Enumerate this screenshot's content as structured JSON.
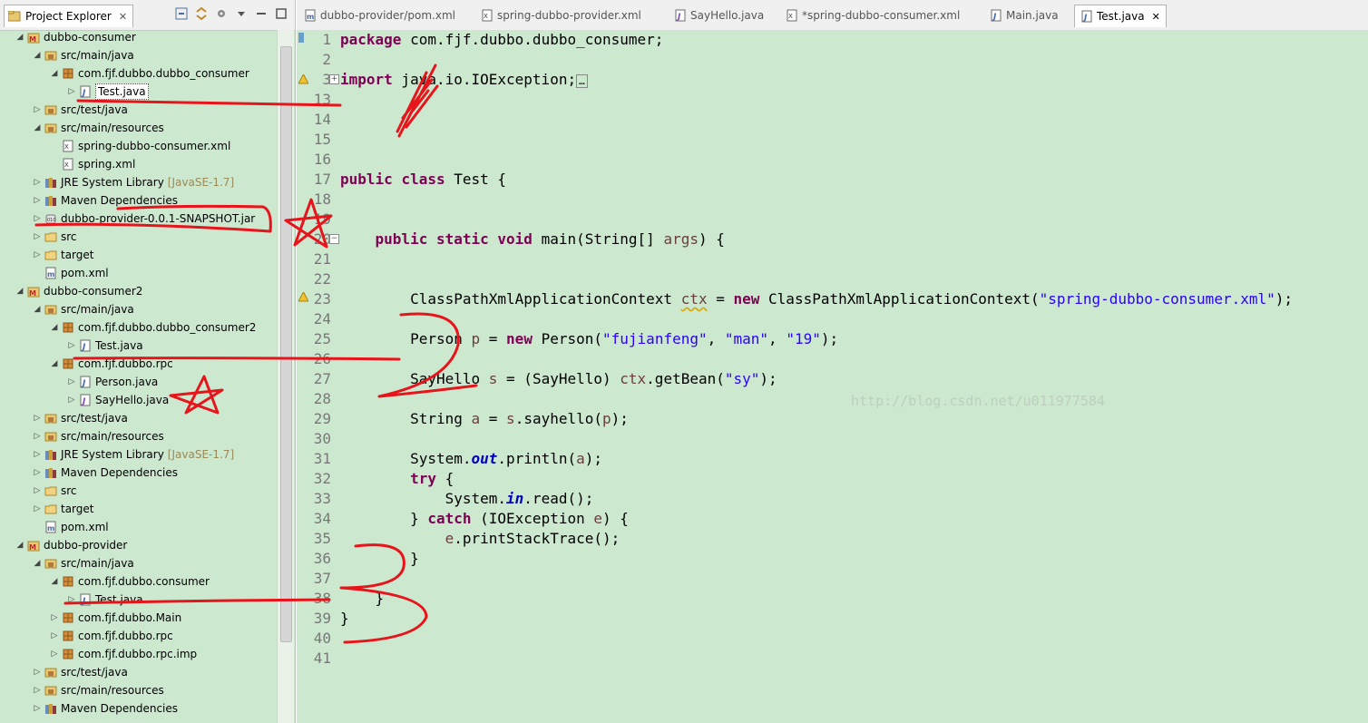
{
  "explorer": {
    "tab_title": "Project Explorer",
    "tab_close": "✕",
    "tree": [
      {
        "label": "dubbo-consumer",
        "level": 0,
        "twisty": "◢",
        "icon": "maven-project-icon"
      },
      {
        "label": "src/main/java",
        "level": 1,
        "twisty": "◢",
        "icon": "source-folder-icon"
      },
      {
        "label": "com.fjf.dubbo.dubbo_consumer",
        "level": 2,
        "twisty": "◢",
        "icon": "package-icon"
      },
      {
        "label": "Test.java",
        "level": 3,
        "twisty": "▷",
        "icon": "java-file-icon",
        "selected": true
      },
      {
        "label": "src/test/java",
        "level": 1,
        "twisty": "▷",
        "icon": "source-folder-icon"
      },
      {
        "label": "src/main/resources",
        "level": 1,
        "twisty": "◢",
        "icon": "source-folder-icon"
      },
      {
        "label": "spring-dubbo-consumer.xml",
        "level": 2,
        "twisty": "",
        "icon": "xml-file-icon"
      },
      {
        "label": "spring.xml",
        "level": 2,
        "twisty": "",
        "icon": "xml-file-icon"
      },
      {
        "label": "JRE System Library",
        "suffix": "[JavaSE-1.7]",
        "level": 1,
        "twisty": "▷",
        "icon": "library-icon"
      },
      {
        "label": "Maven Dependencies",
        "level": 1,
        "twisty": "▷",
        "icon": "library-icon"
      },
      {
        "label": "dubbo-provider-0.0.1-SNAPSHOT.jar",
        "level": 1,
        "twisty": "▷",
        "icon": "jar-icon"
      },
      {
        "label": "src",
        "level": 1,
        "twisty": "▷",
        "icon": "folder-icon"
      },
      {
        "label": "target",
        "level": 1,
        "twisty": "▷",
        "icon": "folder-icon"
      },
      {
        "label": "pom.xml",
        "level": 1,
        "twisty": "",
        "icon": "pom-file-icon"
      },
      {
        "label": "dubbo-consumer2",
        "level": 0,
        "twisty": "◢",
        "icon": "maven-project-icon"
      },
      {
        "label": "src/main/java",
        "level": 1,
        "twisty": "◢",
        "icon": "source-folder-icon"
      },
      {
        "label": "com.fjf.dubbo.dubbo_consumer2",
        "level": 2,
        "twisty": "◢",
        "icon": "package-icon"
      },
      {
        "label": "Test.java",
        "level": 3,
        "twisty": "▷",
        "icon": "java-file-icon"
      },
      {
        "label": "com.fjf.dubbo.rpc",
        "level": 2,
        "twisty": "◢",
        "icon": "package-icon"
      },
      {
        "label": "Person.java",
        "level": 3,
        "twisty": "▷",
        "icon": "java-file-icon"
      },
      {
        "label": "SayHello.java",
        "level": 3,
        "twisty": "▷",
        "icon": "java-interface-icon"
      },
      {
        "label": "src/test/java",
        "level": 1,
        "twisty": "▷",
        "icon": "source-folder-icon"
      },
      {
        "label": "src/main/resources",
        "level": 1,
        "twisty": "▷",
        "icon": "source-folder-icon"
      },
      {
        "label": "JRE System Library",
        "suffix": "[JavaSE-1.7]",
        "level": 1,
        "twisty": "▷",
        "icon": "library-icon"
      },
      {
        "label": "Maven Dependencies",
        "level": 1,
        "twisty": "▷",
        "icon": "library-icon"
      },
      {
        "label": "src",
        "level": 1,
        "twisty": "▷",
        "icon": "folder-icon"
      },
      {
        "label": "target",
        "level": 1,
        "twisty": "▷",
        "icon": "folder-icon"
      },
      {
        "label": "pom.xml",
        "level": 1,
        "twisty": "",
        "icon": "pom-file-icon"
      },
      {
        "label": "dubbo-provider",
        "level": 0,
        "twisty": "◢",
        "icon": "maven-project-icon"
      },
      {
        "label": "src/main/java",
        "level": 1,
        "twisty": "◢",
        "icon": "source-folder-icon"
      },
      {
        "label": "com.fjf.dubbo.consumer",
        "level": 2,
        "twisty": "◢",
        "icon": "package-icon"
      },
      {
        "label": "Test.java",
        "level": 3,
        "twisty": "▷",
        "icon": "java-file-icon"
      },
      {
        "label": "com.fjf.dubbo.Main",
        "level": 2,
        "twisty": "▷",
        "icon": "package-icon"
      },
      {
        "label": "com.fjf.dubbo.rpc",
        "level": 2,
        "twisty": "▷",
        "icon": "package-icon"
      },
      {
        "label": "com.fjf.dubbo.rpc.imp",
        "level": 2,
        "twisty": "▷",
        "icon": "package-icon"
      },
      {
        "label": "src/test/java",
        "level": 1,
        "twisty": "▷",
        "icon": "source-folder-icon"
      },
      {
        "label": "src/main/resources",
        "level": 1,
        "twisty": "▷",
        "icon": "source-folder-icon"
      },
      {
        "label": "Maven Dependencies",
        "level": 1,
        "twisty": "▷",
        "icon": "library-icon"
      }
    ]
  },
  "editor_tabs": [
    {
      "label": "dubbo-provider/pom.xml",
      "icon": "pom-file-icon"
    },
    {
      "label": "spring-dubbo-provider.xml",
      "icon": "xml-file-icon"
    },
    {
      "label": "SayHello.java",
      "icon": "java-interface-icon"
    },
    {
      "label": "*spring-dubbo-consumer.xml",
      "icon": "xml-file-icon"
    },
    {
      "label": "Main.java",
      "icon": "java-file-icon"
    },
    {
      "label": "Test.java",
      "icon": "java-file-icon",
      "active": true,
      "close": "✕"
    }
  ],
  "editor": {
    "line_numbers": [
      "1",
      "2",
      "3",
      "13",
      "14",
      "15",
      "16",
      "17",
      "18",
      "19",
      "20",
      "21",
      "22",
      "23",
      "24",
      "25",
      "26",
      "27",
      "28",
      "29",
      "30",
      "31",
      "32",
      "33",
      "34",
      "35",
      "36",
      "37",
      "38",
      "39",
      "40",
      "41"
    ],
    "watermark": "http://blog.csdn.net/u011977584"
  },
  "colors": {
    "background": "#cce8cf",
    "keyword": "#7f0055",
    "string": "#2a00ff",
    "static_field": "#0000c0",
    "local_var": "#6a3e3e",
    "annotation_scribble": "#e8141b"
  }
}
